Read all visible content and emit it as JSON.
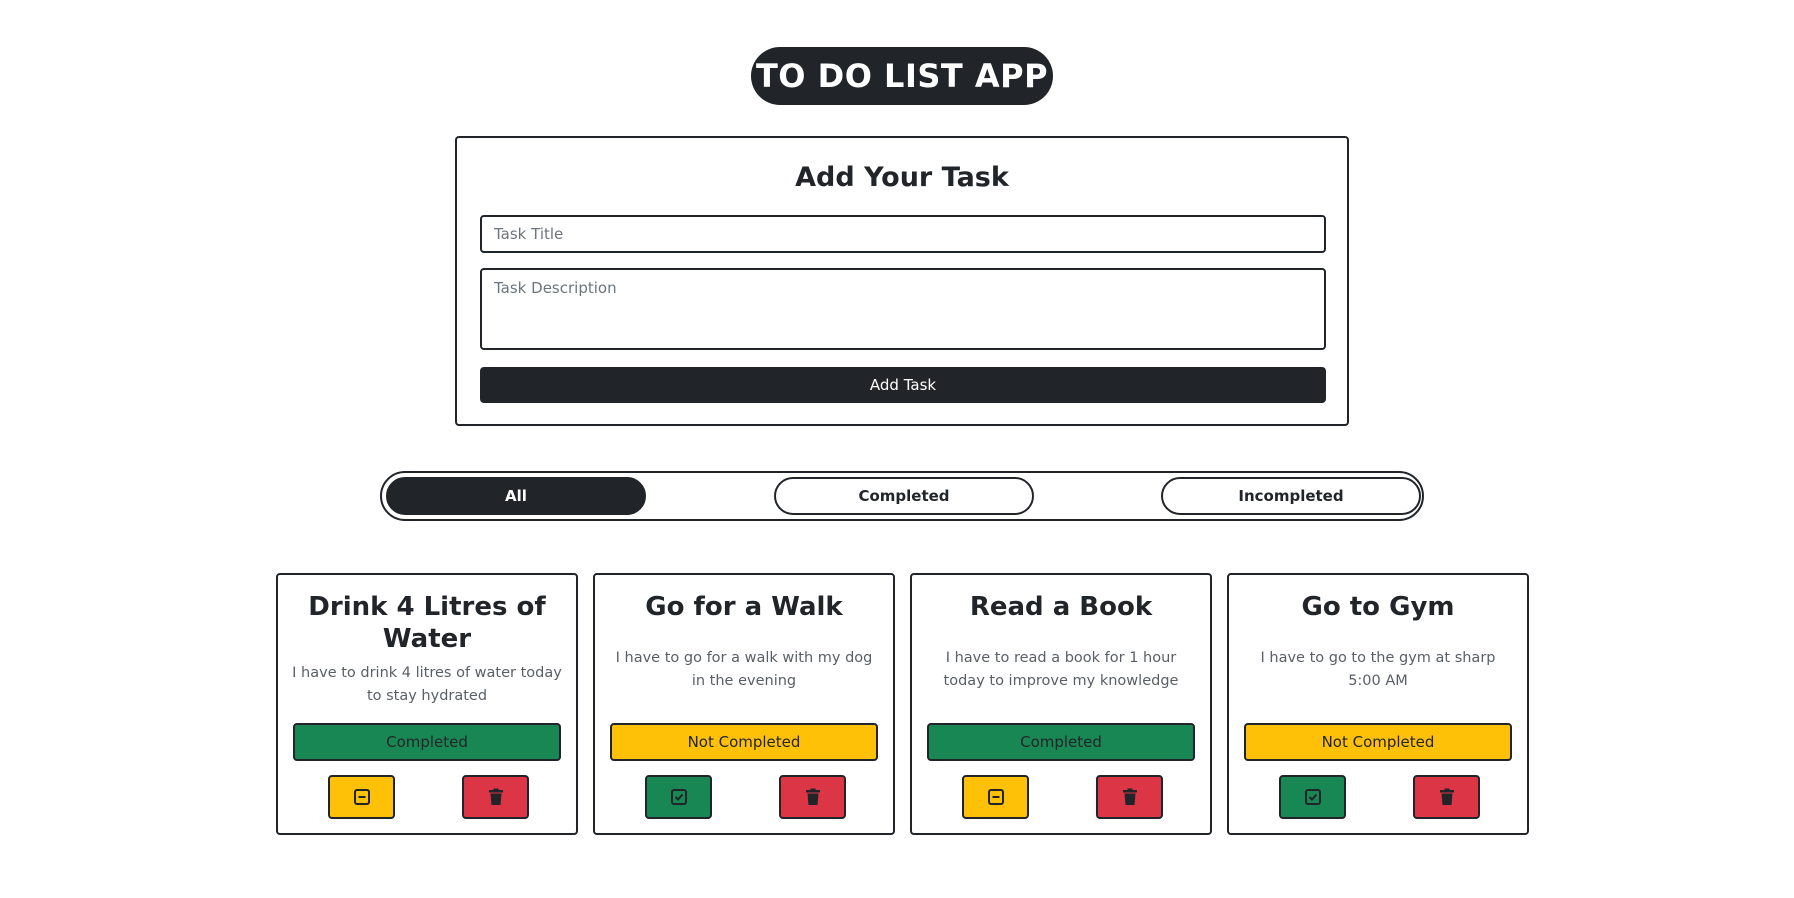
{
  "header": {
    "title": "TO DO LIST APP"
  },
  "form": {
    "heading": "Add Your Task",
    "title_placeholder": "Task Title",
    "description_placeholder": "Task Description",
    "submit_label": "Add Task"
  },
  "filters": {
    "active": "All",
    "items": [
      {
        "label": "All"
      },
      {
        "label": "Completed"
      },
      {
        "label": "Incompleted"
      }
    ]
  },
  "tasks": [
    {
      "title": "Drink 4 Litres of Water",
      "description": "I have to drink 4 litres of water today to stay hydrated",
      "status": "Completed",
      "toggle_icon": "minus-square-icon"
    },
    {
      "title": "Go for a Walk",
      "description": "I have to go for a walk with my dog in the evening",
      "status": "Not Completed",
      "toggle_icon": "check-square-icon"
    },
    {
      "title": "Read a Book",
      "description": "I have to read a book for 1 hour today to improve my knowledge",
      "status": "Completed",
      "toggle_icon": "minus-square-icon"
    },
    {
      "title": "Go to Gym",
      "description": "I have to go to the gym at sharp 5:00 AM",
      "status": "Not Completed",
      "toggle_icon": "check-square-icon"
    }
  ],
  "colors": {
    "dark": "#212529",
    "completed": "#198754",
    "not_completed": "#ffc107",
    "delete": "#dc3545"
  }
}
